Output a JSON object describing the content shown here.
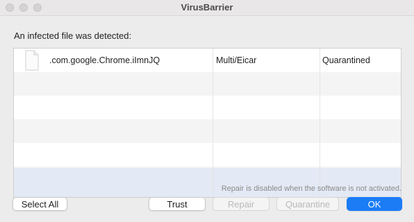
{
  "window": {
    "title": "VirusBarrier"
  },
  "dialog": {
    "heading": "An infected file was detected:",
    "note": "Repair is disabled when the software is not activated."
  },
  "table": {
    "rows": [
      {
        "name": ".com.google.Chrome.iImnJQ",
        "threat": "Multi/Eicar",
        "status": "Quarantined",
        "icon": "document-icon"
      }
    ]
  },
  "buttons": {
    "select_all": "Select All",
    "trust": "Trust",
    "repair": "Repair",
    "quarantine": "Quarantine",
    "ok": "OK"
  },
  "colors": {
    "primary": "#1b7cf6",
    "selected_row": "#e3e9f5"
  }
}
